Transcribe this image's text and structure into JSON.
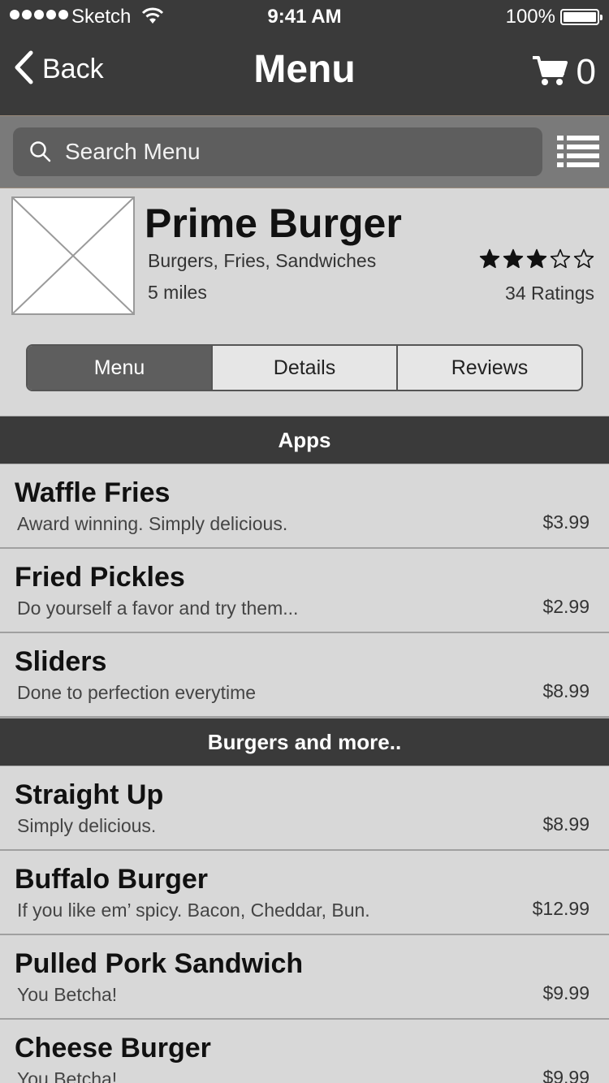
{
  "status": {
    "carrier": "Sketch",
    "time": "9:41 AM",
    "battery": "100%"
  },
  "nav": {
    "back_label": "Back",
    "title": "Menu",
    "cart_count": "0"
  },
  "search": {
    "placeholder": "Search Menu"
  },
  "restaurant": {
    "name": "Prime Burger",
    "categories": "Burgers, Fries, Sandwiches",
    "distance": "5 miles",
    "rating": 3,
    "rating_max": 5,
    "ratings_count": "34 Ratings"
  },
  "tabs": [
    {
      "label": "Menu",
      "active": true
    },
    {
      "label": "Details",
      "active": false
    },
    {
      "label": "Reviews",
      "active": false
    }
  ],
  "sections": [
    {
      "title": "Apps",
      "items": [
        {
          "name": "Waffle Fries",
          "desc": "Award winning.  Simply delicious.",
          "price": "$3.99"
        },
        {
          "name": "Fried Pickles",
          "desc": "Do yourself a favor and try them...",
          "price": "$2.99"
        },
        {
          "name": "Sliders",
          "desc": "Done to perfection everytime",
          "price": "$8.99"
        }
      ]
    },
    {
      "title": "Burgers and more..",
      "items": [
        {
          "name": "Straight Up",
          "desc": "Simply delicious.",
          "price": "$8.99"
        },
        {
          "name": "Buffalo Burger",
          "desc": "If you like em’ spicy.  Bacon, Cheddar, Bun.",
          "price": "$12.99"
        },
        {
          "name": "Pulled Pork Sandwich",
          "desc": "You Betcha!",
          "price": "$9.99"
        },
        {
          "name": "Cheese Burger",
          "desc": "You Betcha!",
          "price": "$9.99"
        }
      ]
    }
  ]
}
